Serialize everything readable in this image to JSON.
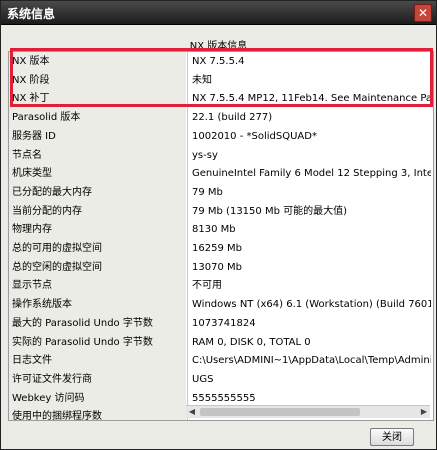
{
  "window": {
    "title": "系统信息",
    "close_icon": "✕"
  },
  "section": {
    "heading": "NX 版本信息"
  },
  "rows": [
    {
      "label": "NX 版本",
      "value": "NX 7.5.5.4"
    },
    {
      "label": "NX 阶段",
      "value": "未知"
    },
    {
      "label": "NX 补丁",
      "value": "NX 7.5.5.4 MP12, 11Feb14.  See Maintenance Pac"
    },
    {
      "label": "Parasolid 版本",
      "value": "22.1 (build 277)"
    },
    {
      "label": "服务器 ID",
      "value": "1002010 - *SolidSQUAD*"
    },
    {
      "label": "节点名",
      "value": "ys-sy"
    },
    {
      "label": "机床类型",
      "value": "GenuineIntel Family 6 Model 12 Stepping 3, Intel(R"
    },
    {
      "label": "已分配的最大内存",
      "value": "79 Mb"
    },
    {
      "label": "当前分配的内存",
      "value": "79 Mb (13150 Mb 可能的最大值)"
    },
    {
      "label": "物理内存",
      "value": "8130 Mb"
    },
    {
      "label": "总的可用的虚拟空间",
      "value": "16259 Mb"
    },
    {
      "label": "总的空闲的虚拟空间",
      "value": "13070 Mb"
    },
    {
      "label": "显示节点",
      "value": "不可用"
    },
    {
      "label": "操作系统版本",
      "value": "Windows NT (x64) 6.1 (Workstation) (Build 7601: S"
    },
    {
      "label": "最大的 Parasolid Undo 字节数",
      "value": "1073741824"
    },
    {
      "label": "实际的 Parasolid Undo 字节数",
      "value": "RAM 0, DISK 0, TOTAL 0"
    },
    {
      "label": "日志文件",
      "value": "C:\\Users\\ADMINI~1\\AppData\\Local\\Temp\\Admini"
    },
    {
      "label": "许可证文件发行商",
      "value": "UGS"
    },
    {
      "label": "Webkey 访问码",
      "value": "5555555555"
    },
    {
      "label": "使用中的捆绑程序数",
      "value": ""
    }
  ],
  "footer": {
    "close_label": "关闭"
  },
  "colors": {
    "highlight": "#e0203a",
    "titlebar": "#1c1c1c"
  }
}
